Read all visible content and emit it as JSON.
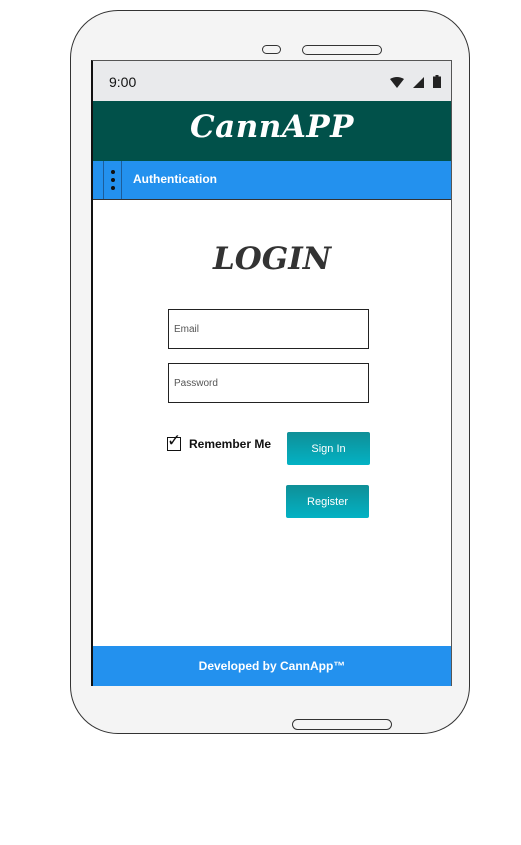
{
  "status_bar": {
    "time": "9:00",
    "icons": [
      "wifi-icon",
      "signal-icon",
      "battery-icon"
    ]
  },
  "app": {
    "title": "CannAPP"
  },
  "toolbar": {
    "menu_icon": "more-vert-icon",
    "title": "Authentication"
  },
  "login": {
    "heading": "LOGIN",
    "email": {
      "value": "",
      "placeholder": "Email"
    },
    "password": {
      "value": "",
      "placeholder": "Password"
    },
    "remember_me": {
      "label": "Remember Me",
      "checked": true
    },
    "sign_in_label": "Sign In",
    "register_label": "Register"
  },
  "footer": {
    "text": "Developed by CannApp™"
  },
  "colors": {
    "appbar": "#01514a",
    "toolbar": "#2391ee",
    "button": "#03b2c4"
  }
}
